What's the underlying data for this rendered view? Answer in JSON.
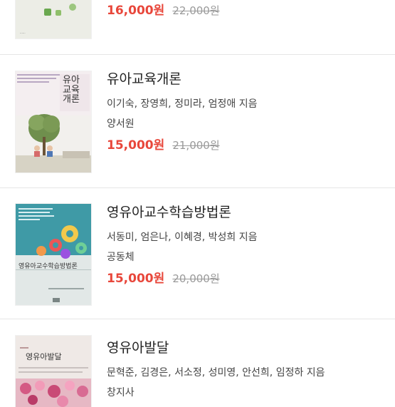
{
  "books": [
    {
      "title": "",
      "authors": "",
      "publisher": "",
      "sale_price": "16,000원",
      "original_price": "22,000원"
    },
    {
      "title": "유아교육개론",
      "authors": "이기숙, 장영희, 정미라, 엄정애 지음",
      "publisher": "양서원",
      "sale_price": "15,000원",
      "original_price": "21,000원",
      "cover_title_lines": [
        "유아",
        "교육",
        "개론"
      ]
    },
    {
      "title": "영유아교수학습방법론",
      "authors": "서동미, 엄은나, 이혜경, 박성희 지음",
      "publisher": "공동체",
      "sale_price": "15,000원",
      "original_price": "20,000원",
      "cover_title": "영유아교수학습방법론"
    },
    {
      "title": "영유아발달",
      "authors": "문혁준, 김경은, 서소정, 성미영, 안선희, 임정하 지음",
      "publisher": "창지사",
      "sale_price": "",
      "original_price": "",
      "cover_title": "영유아발달"
    }
  ],
  "colors": {
    "sale_price": "#e8473b",
    "original_price": "#9a9a9a",
    "divider": "#e6e6e6"
  }
}
